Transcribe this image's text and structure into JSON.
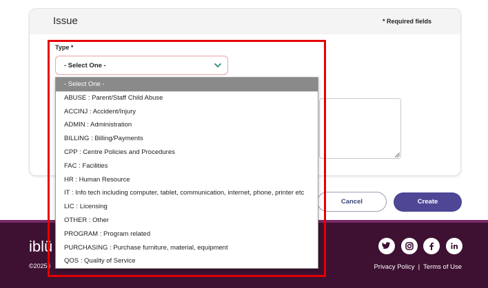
{
  "form": {
    "title": "Issue",
    "required_note": "* Required fields",
    "type_label": "Type *",
    "type_value": "- Select One -"
  },
  "buttons": {
    "cancel": "Cancel",
    "create": "Create"
  },
  "dropdown": {
    "options": [
      "- Select One -",
      "ABUSE : Parent/Staff Child Abuse",
      "ACCINJ : Accident/Injury",
      "ADMIN : Administration",
      "BILLING : Billing/Payments",
      "CPP : Centre Policies and Procedures",
      "FAC : Facilities",
      "HR : Human Resource",
      "IT : Info tech including computer, tablet, communication, internet, phone, printer etc",
      "LIC : Licensing",
      "OTHER : Other",
      "PROGRAM : Program related",
      "PURCHASING : Purchase furniture, material, equipment",
      "QOS : Quality of Service"
    ],
    "selected_index": 0
  },
  "footer": {
    "logo": "iblü",
    "copyright": "©2025 i",
    "privacy": "Privacy Policy",
    "separator": "|",
    "terms": "Terms of Use",
    "social_icons": [
      "twitter-icon",
      "instagram-icon",
      "facebook-icon",
      "linkedin-icon"
    ]
  },
  "colors": {
    "footer_bg": "#3e1132",
    "create_button": "#4d4795",
    "highlight": "#e60000",
    "selected_option": "#8a8a8a"
  }
}
